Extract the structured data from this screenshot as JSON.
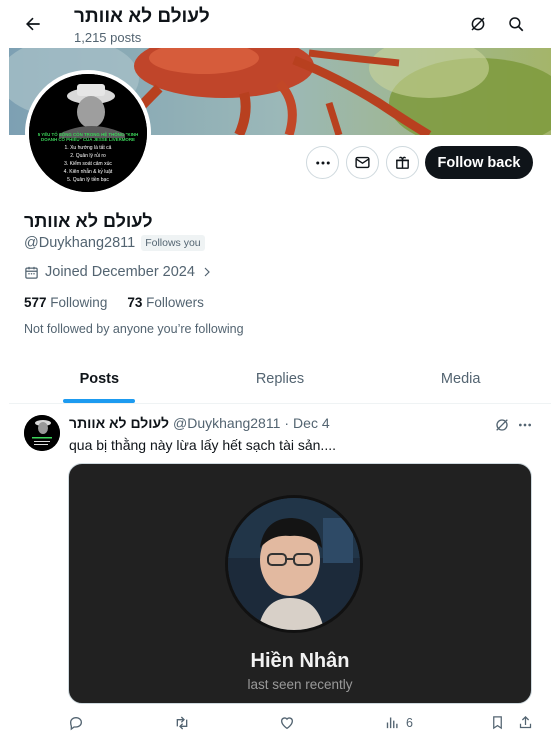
{
  "header": {
    "title": "לעולם לא אוותר",
    "posts_count": "1,215 posts"
  },
  "profile": {
    "name": "לעולם לא אוותר",
    "handle": "@Duykhang2811",
    "follows_you": "Follows you",
    "joined": "Joined December 2024",
    "following_count": "577",
    "following_label": "Following",
    "followers_count": "73",
    "followers_label": "Followers",
    "not_followed": "Not followed by anyone you’re following",
    "follow_button": "Follow back"
  },
  "avatar_lines": [
    "5 YẾU TỐ SỐNG CÒN TRONG HỆ THỐNG \"KINH DOANH CỔ PHIẾU\" CỦA JESSE LIVERMORE",
    "1. Xu hướng là tất cả",
    "2. Quản lý rủi ro",
    "3. Kiểm soát cảm xúc",
    "4. Kiên nhẫn & kỷ luật",
    "5. Quản lý tiền bạc"
  ],
  "tabs": [
    {
      "label": "Posts",
      "active": true
    },
    {
      "label": "Replies",
      "active": false
    },
    {
      "label": "Media",
      "active": false
    }
  ],
  "post": {
    "author": "לעולם לא אוותר",
    "handle": "@Duykhang2811",
    "separator": "·",
    "date": "Dec 4",
    "text": "qua bị thằng này lừa lấy hết sạch tài sản....",
    "media": {
      "name": "Hiền Nhân",
      "status": "last seen recently"
    },
    "views": "6"
  },
  "colors": {
    "accent": "#1d9bf0",
    "text": "#0f1419",
    "muted": "#536471",
    "button_dark": "#0f1419"
  },
  "icons": [
    "back-arrow-icon",
    "grok-icon",
    "search-icon",
    "more-icon",
    "message-icon",
    "gift-icon",
    "calendar-icon",
    "chevron-right-icon",
    "reply-icon",
    "retweet-icon",
    "like-icon",
    "views-icon",
    "bookmark-icon",
    "share-icon"
  ]
}
